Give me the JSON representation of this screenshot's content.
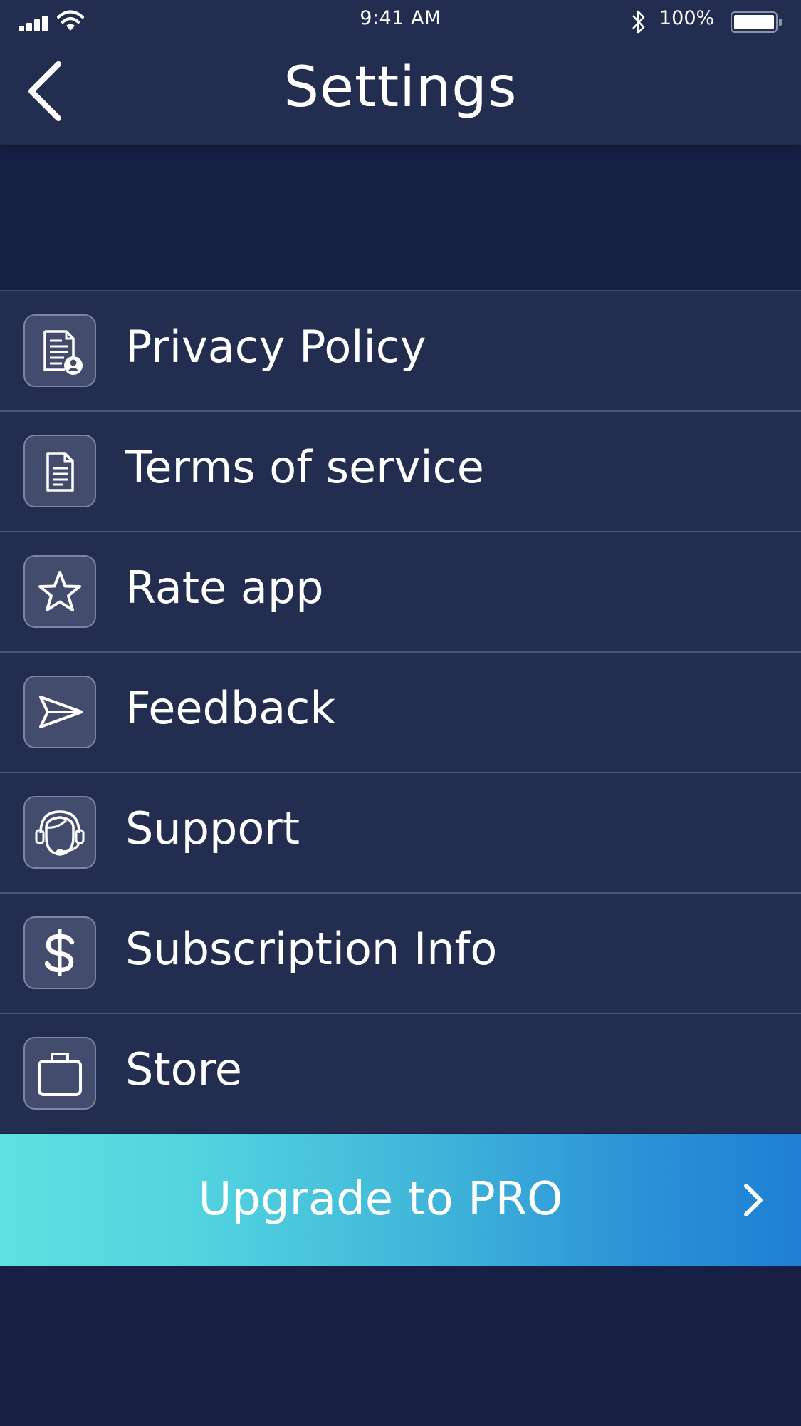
{
  "status_bar": {
    "time": "9:41 AM",
    "battery_percent": "100%"
  },
  "header": {
    "title": "Settings",
    "back_icon": "chevron-left-icon"
  },
  "menu": {
    "items": [
      {
        "label": "Privacy Policy",
        "icon": "privacy-document-icon"
      },
      {
        "label": "Terms of service",
        "icon": "document-icon"
      },
      {
        "label": "Rate app",
        "icon": "star-icon"
      },
      {
        "label": "Feedback",
        "icon": "paper-plane-icon"
      },
      {
        "label": "Support",
        "icon": "headset-icon"
      },
      {
        "label": "Subscription Info",
        "icon": "dollar-icon"
      },
      {
        "label": "Store",
        "icon": "shopping-bag-icon"
      }
    ]
  },
  "upgrade": {
    "label": "Upgrade to PRO",
    "icon": "chevron-right-icon"
  },
  "colors": {
    "background": "#172044",
    "header": "#222d4f",
    "row": "#222d4f",
    "icon_box": "#434c6c",
    "gradient_start": "#5ee0e1",
    "gradient_end": "#1f7fd4"
  }
}
